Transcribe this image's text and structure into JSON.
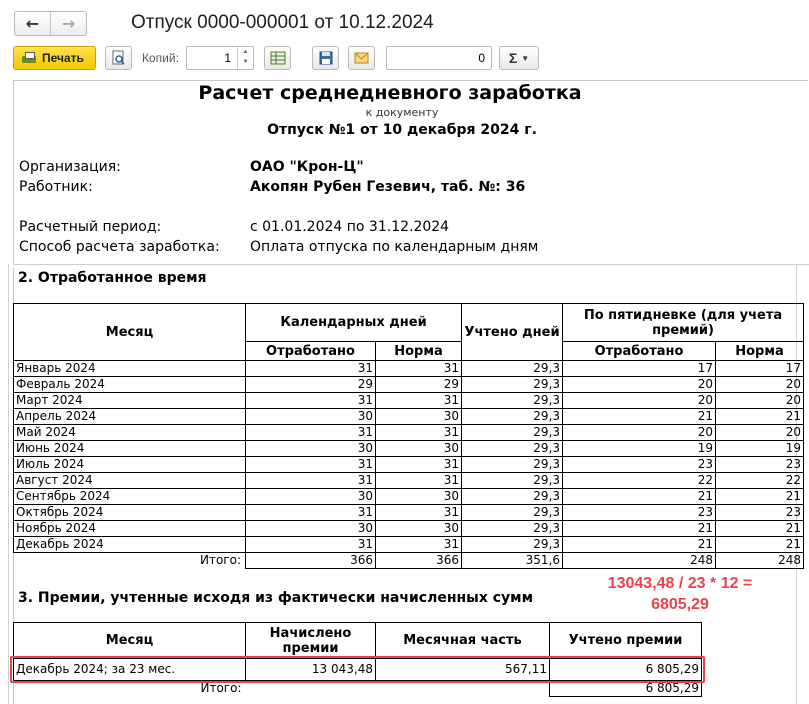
{
  "window": {
    "title": "Отпуск 0000-000001 от 10.12.2024",
    "back_icon": "arrow-left-icon",
    "forward_icon": "arrow-right-icon"
  },
  "toolbar": {
    "print_label": "Печать",
    "copies_label": "Копий:",
    "copies_value": "1",
    "number_value": "0",
    "sum_label": "Σ",
    "accent": "#f5d000"
  },
  "document": {
    "title": "Расчет среднедневного заработка",
    "subtitle": "к документу",
    "reference": "Отпуск №1 от 10 декабря 2024 г.",
    "info": [
      {
        "label": "Организация:",
        "value": "ОАО \"Крон-Ц\"",
        "bold": true
      },
      {
        "label": "Работник:",
        "value": "Акопян Рубен Гезевич, таб. №: 36",
        "bold": true
      },
      {
        "label": "Расчетный период:",
        "value": "с 01.01.2024 по 31.12.2024",
        "bold": false
      },
      {
        "label": "Способ расчета заработка:",
        "value": "Оплата отпуска по календарным дням",
        "bold": false
      }
    ]
  },
  "section2": {
    "title": "2. Отработанное время",
    "headers": {
      "month": "Месяц",
      "calendar_days": "Календарных дней",
      "worked": "Отработано",
      "norm": "Норма",
      "counted_days": "Учтено дней",
      "five_day": "По пятидневке (для учета премий)",
      "worked2": "Отработано",
      "norm2": "Норма"
    },
    "rows": [
      [
        "Январь 2024",
        "31",
        "31",
        "29,3",
        "17",
        "17"
      ],
      [
        "Февраль 2024",
        "29",
        "29",
        "29,3",
        "20",
        "20"
      ],
      [
        "Март 2024",
        "31",
        "31",
        "29,3",
        "20",
        "20"
      ],
      [
        "Апрель 2024",
        "30",
        "30",
        "29,3",
        "21",
        "21"
      ],
      [
        "Май 2024",
        "31",
        "31",
        "29,3",
        "20",
        "20"
      ],
      [
        "Июнь 2024",
        "30",
        "30",
        "29,3",
        "19",
        "19"
      ],
      [
        "Июль 2024",
        "31",
        "31",
        "29,3",
        "23",
        "23"
      ],
      [
        "Август 2024",
        "31",
        "31",
        "29,3",
        "22",
        "22"
      ],
      [
        "Сентябрь 2024",
        "30",
        "30",
        "29,3",
        "21",
        "21"
      ],
      [
        "Октябрь 2024",
        "31",
        "31",
        "29,3",
        "23",
        "23"
      ],
      [
        "Ноябрь 2024",
        "30",
        "30",
        "29,3",
        "21",
        "21"
      ],
      [
        "Декабрь 2024",
        "31",
        "31",
        "29,3",
        "21",
        "21"
      ]
    ],
    "total": {
      "label": "Итого:",
      "values": [
        "366",
        "366",
        "351,6",
        "248",
        "248"
      ]
    }
  },
  "section3": {
    "title": "3. Премии, учтенные исходя из фактически начисленных сумм",
    "headers": {
      "month": "Месяц",
      "accrued": "Начислено премии",
      "monthly_part": "Месячная часть",
      "counted": "Учтено премии"
    },
    "row": [
      "Декабрь 2024; за 23 мес.",
      "13 043,48",
      "567,11",
      "6 805,29"
    ],
    "total": {
      "label": "Итого:",
      "value": "6 805,29"
    }
  },
  "annotation": {
    "line1": "13043,48 / 23 * 12 =",
    "line2": "6805,29",
    "color": "#e8434b"
  }
}
